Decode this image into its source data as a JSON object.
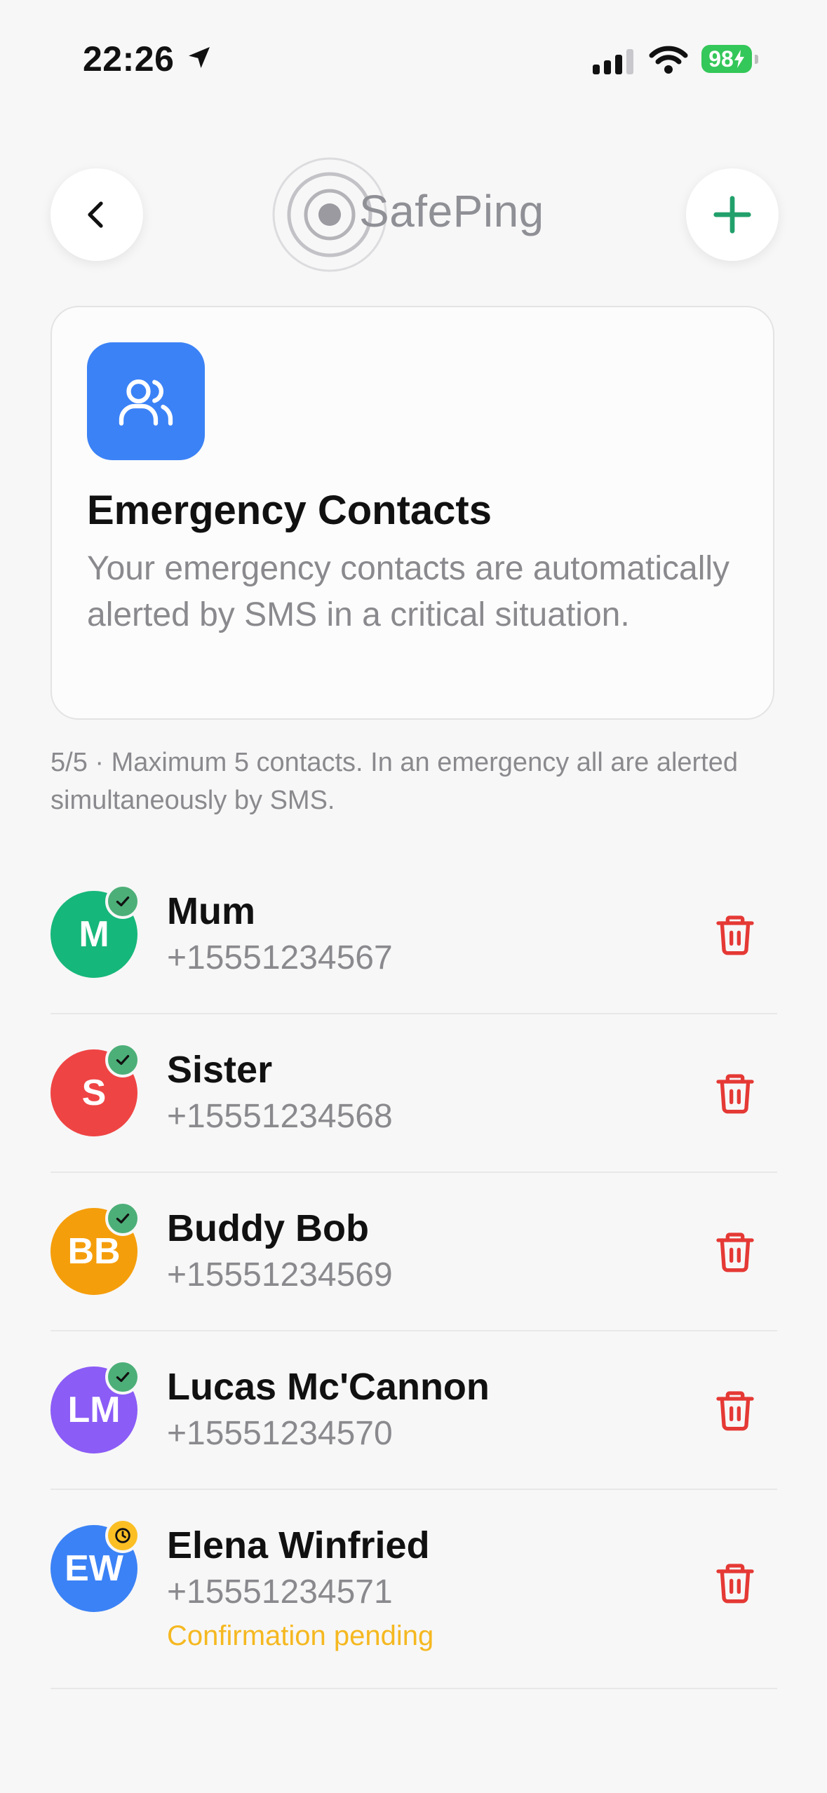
{
  "status_bar": {
    "time": "22:26",
    "battery": "98"
  },
  "header": {
    "app_name": "SafePing"
  },
  "info_card": {
    "title": "Emergency Contacts",
    "description": "Your emergency contacts are automatically alerted by SMS in a critical situation."
  },
  "limit_note": "5/5 · Maximum 5 contacts. In an emergency all are alerted simultaneously by SMS.",
  "contacts": [
    {
      "initials": "M",
      "name": "Mum",
      "phone": "+15551234567",
      "color": "#16b77a",
      "status": "confirmed"
    },
    {
      "initials": "S",
      "name": "Sister",
      "phone": "+15551234568",
      "color": "#ef4444",
      "status": "confirmed"
    },
    {
      "initials": "BB",
      "name": "Buddy Bob",
      "phone": "+15551234569",
      "color": "#f59e0b",
      "status": "confirmed"
    },
    {
      "initials": "LM",
      "name": "Lucas Mc'Cannon",
      "phone": "+15551234570",
      "color": "#8b5cf6",
      "status": "confirmed"
    },
    {
      "initials": "EW",
      "name": "Elena Winfried",
      "phone": "+15551234571",
      "color": "#3b82f6",
      "status": "pending",
      "status_text": "Confirmation pending"
    }
  ],
  "colors": {
    "accent_green": "#22a06b",
    "danger": "#e53935",
    "pending": "#f5b820",
    "card_icon_bg": "#3b82f6"
  }
}
